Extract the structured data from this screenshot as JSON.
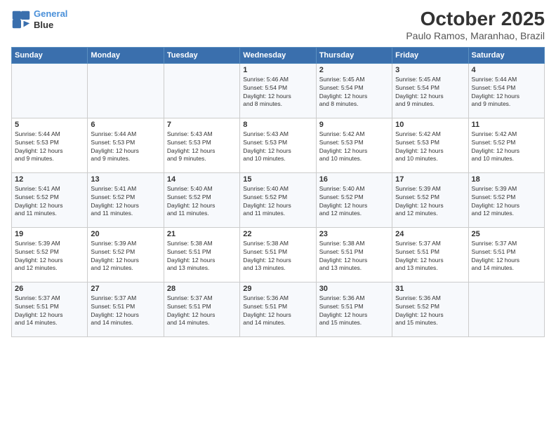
{
  "header": {
    "logo_line1": "General",
    "logo_line2": "Blue",
    "title": "October 2025",
    "subtitle": "Paulo Ramos, Maranhao, Brazil"
  },
  "days_of_week": [
    "Sunday",
    "Monday",
    "Tuesday",
    "Wednesday",
    "Thursday",
    "Friday",
    "Saturday"
  ],
  "weeks": [
    [
      {
        "day": "",
        "info": ""
      },
      {
        "day": "",
        "info": ""
      },
      {
        "day": "",
        "info": ""
      },
      {
        "day": "1",
        "info": "Sunrise: 5:46 AM\nSunset: 5:54 PM\nDaylight: 12 hours\nand 8 minutes."
      },
      {
        "day": "2",
        "info": "Sunrise: 5:45 AM\nSunset: 5:54 PM\nDaylight: 12 hours\nand 8 minutes."
      },
      {
        "day": "3",
        "info": "Sunrise: 5:45 AM\nSunset: 5:54 PM\nDaylight: 12 hours\nand 9 minutes."
      },
      {
        "day": "4",
        "info": "Sunrise: 5:44 AM\nSunset: 5:54 PM\nDaylight: 12 hours\nand 9 minutes."
      }
    ],
    [
      {
        "day": "5",
        "info": "Sunrise: 5:44 AM\nSunset: 5:53 PM\nDaylight: 12 hours\nand 9 minutes."
      },
      {
        "day": "6",
        "info": "Sunrise: 5:44 AM\nSunset: 5:53 PM\nDaylight: 12 hours\nand 9 minutes."
      },
      {
        "day": "7",
        "info": "Sunrise: 5:43 AM\nSunset: 5:53 PM\nDaylight: 12 hours\nand 9 minutes."
      },
      {
        "day": "8",
        "info": "Sunrise: 5:43 AM\nSunset: 5:53 PM\nDaylight: 12 hours\nand 10 minutes."
      },
      {
        "day": "9",
        "info": "Sunrise: 5:42 AM\nSunset: 5:53 PM\nDaylight: 12 hours\nand 10 minutes."
      },
      {
        "day": "10",
        "info": "Sunrise: 5:42 AM\nSunset: 5:53 PM\nDaylight: 12 hours\nand 10 minutes."
      },
      {
        "day": "11",
        "info": "Sunrise: 5:42 AM\nSunset: 5:52 PM\nDaylight: 12 hours\nand 10 minutes."
      }
    ],
    [
      {
        "day": "12",
        "info": "Sunrise: 5:41 AM\nSunset: 5:52 PM\nDaylight: 12 hours\nand 11 minutes."
      },
      {
        "day": "13",
        "info": "Sunrise: 5:41 AM\nSunset: 5:52 PM\nDaylight: 12 hours\nand 11 minutes."
      },
      {
        "day": "14",
        "info": "Sunrise: 5:40 AM\nSunset: 5:52 PM\nDaylight: 12 hours\nand 11 minutes."
      },
      {
        "day": "15",
        "info": "Sunrise: 5:40 AM\nSunset: 5:52 PM\nDaylight: 12 hours\nand 11 minutes."
      },
      {
        "day": "16",
        "info": "Sunrise: 5:40 AM\nSunset: 5:52 PM\nDaylight: 12 hours\nand 12 minutes."
      },
      {
        "day": "17",
        "info": "Sunrise: 5:39 AM\nSunset: 5:52 PM\nDaylight: 12 hours\nand 12 minutes."
      },
      {
        "day": "18",
        "info": "Sunrise: 5:39 AM\nSunset: 5:52 PM\nDaylight: 12 hours\nand 12 minutes."
      }
    ],
    [
      {
        "day": "19",
        "info": "Sunrise: 5:39 AM\nSunset: 5:52 PM\nDaylight: 12 hours\nand 12 minutes."
      },
      {
        "day": "20",
        "info": "Sunrise: 5:39 AM\nSunset: 5:52 PM\nDaylight: 12 hours\nand 12 minutes."
      },
      {
        "day": "21",
        "info": "Sunrise: 5:38 AM\nSunset: 5:51 PM\nDaylight: 12 hours\nand 13 minutes."
      },
      {
        "day": "22",
        "info": "Sunrise: 5:38 AM\nSunset: 5:51 PM\nDaylight: 12 hours\nand 13 minutes."
      },
      {
        "day": "23",
        "info": "Sunrise: 5:38 AM\nSunset: 5:51 PM\nDaylight: 12 hours\nand 13 minutes."
      },
      {
        "day": "24",
        "info": "Sunrise: 5:37 AM\nSunset: 5:51 PM\nDaylight: 12 hours\nand 13 minutes."
      },
      {
        "day": "25",
        "info": "Sunrise: 5:37 AM\nSunset: 5:51 PM\nDaylight: 12 hours\nand 14 minutes."
      }
    ],
    [
      {
        "day": "26",
        "info": "Sunrise: 5:37 AM\nSunset: 5:51 PM\nDaylight: 12 hours\nand 14 minutes."
      },
      {
        "day": "27",
        "info": "Sunrise: 5:37 AM\nSunset: 5:51 PM\nDaylight: 12 hours\nand 14 minutes."
      },
      {
        "day": "28",
        "info": "Sunrise: 5:37 AM\nSunset: 5:51 PM\nDaylight: 12 hours\nand 14 minutes."
      },
      {
        "day": "29",
        "info": "Sunrise: 5:36 AM\nSunset: 5:51 PM\nDaylight: 12 hours\nand 14 minutes."
      },
      {
        "day": "30",
        "info": "Sunrise: 5:36 AM\nSunset: 5:51 PM\nDaylight: 12 hours\nand 15 minutes."
      },
      {
        "day": "31",
        "info": "Sunrise: 5:36 AM\nSunset: 5:52 PM\nDaylight: 12 hours\nand 15 minutes."
      },
      {
        "day": "",
        "info": ""
      }
    ]
  ]
}
